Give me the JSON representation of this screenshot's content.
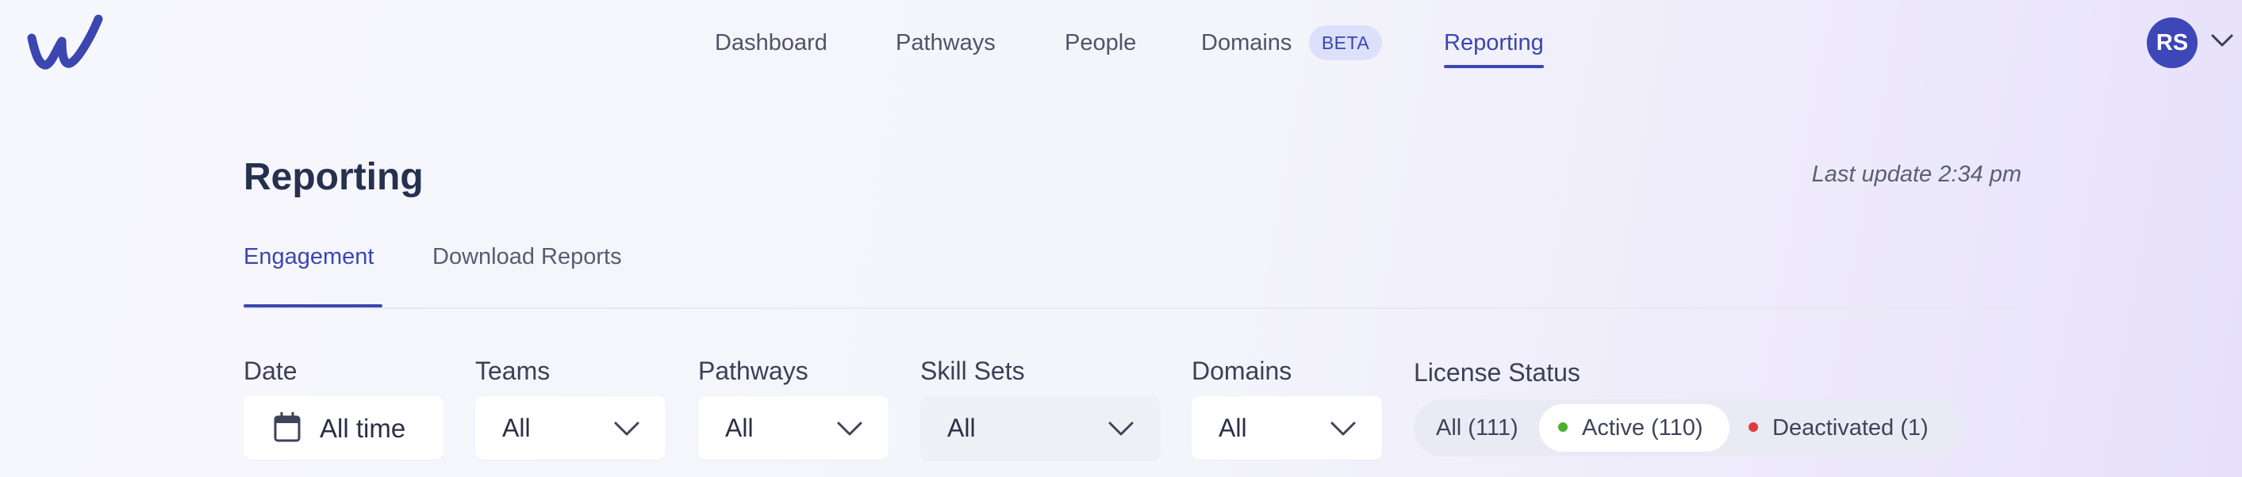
{
  "nav": {
    "items": [
      {
        "label": "Dashboard"
      },
      {
        "label": "Pathways"
      },
      {
        "label": "People"
      },
      {
        "label": "Domains"
      },
      {
        "label": "Reporting"
      }
    ],
    "beta_badge": "BETA",
    "active": "Reporting"
  },
  "user": {
    "initials": "RS"
  },
  "header": {
    "title": "Reporting",
    "last_update": "Last update 2:34 pm"
  },
  "tabs": [
    {
      "label": "Engagement",
      "active": true
    },
    {
      "label": "Download Reports",
      "active": false
    }
  ],
  "filters": {
    "date": {
      "label": "Date",
      "value": "All time",
      "icon": "calendar-icon"
    },
    "teams": {
      "label": "Teams",
      "value": "All"
    },
    "pathways": {
      "label": "Pathways",
      "value": "All"
    },
    "skill_sets": {
      "label": "Skill Sets",
      "value": "All"
    },
    "domains": {
      "label": "Domains",
      "value": "All"
    }
  },
  "license_status": {
    "label": "License Status",
    "options": [
      {
        "label": "All (111)"
      },
      {
        "label": "Active (110)",
        "selected": true
      },
      {
        "label": "Deactivated (1)"
      }
    ]
  },
  "colors": {
    "accent": "#3b46b0",
    "avatar": "#3d47b8",
    "active_dot": "#4caf2e",
    "inactive_dot": "#e03b3b"
  }
}
